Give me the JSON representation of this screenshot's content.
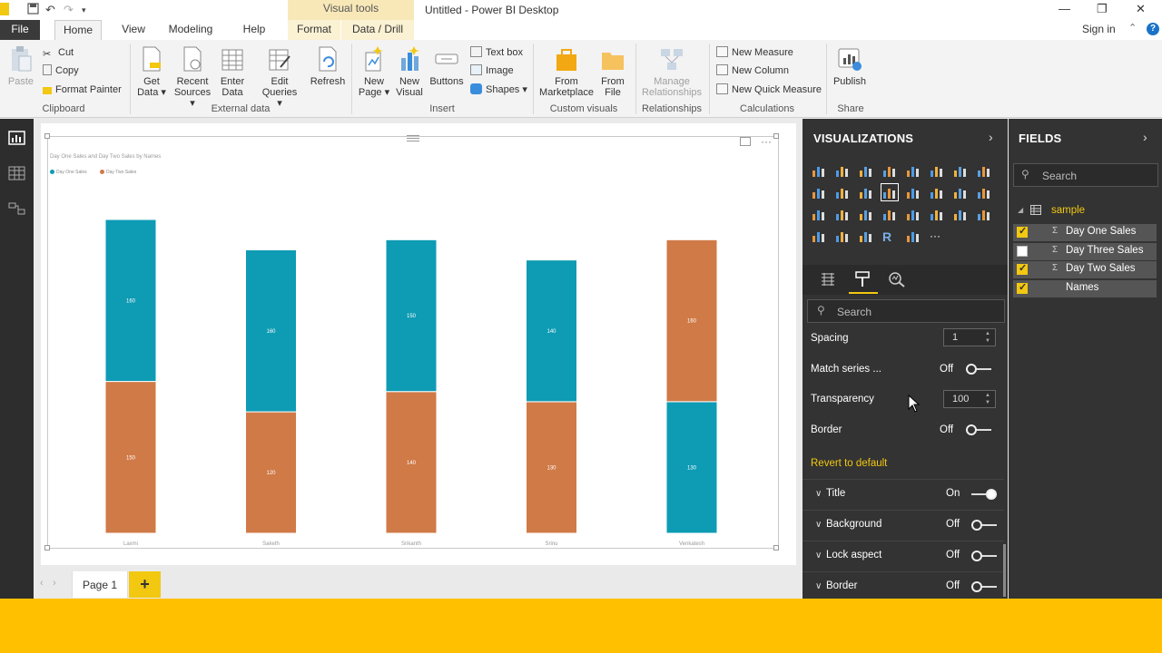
{
  "app": {
    "title": "Untitled - Power BI Desktop",
    "context_tab_group": "Visual tools",
    "sign_in": "Sign in"
  },
  "tabs": [
    "File",
    "Home",
    "View",
    "Modeling",
    "Help",
    "Format",
    "Data / Drill"
  ],
  "ribbon": {
    "clipboard": {
      "paste": "Paste",
      "cut": "Cut",
      "copy": "Copy",
      "format_painter": "Format Painter",
      "group": "Clipboard"
    },
    "external_data": {
      "get_data_1": "Get",
      "get_data_2": "Data ▾",
      "recent_1": "Recent",
      "recent_2": "Sources ▾",
      "enter_1": "Enter",
      "enter_2": "Data",
      "edit_1": "Edit",
      "edit_2": "Queries ▾",
      "refresh": "Refresh",
      "group": "External data"
    },
    "insert": {
      "new_page_1": "New",
      "new_page_2": "Page ▾",
      "new_visual_1": "New",
      "new_visual_2": "Visual",
      "buttons": "Buttons",
      "text_box": "Text box",
      "image": "Image",
      "shapes": "Shapes ▾",
      "group": "Insert"
    },
    "custom_visuals": {
      "from_marketplace_1": "From",
      "from_marketplace_2": "Marketplace",
      "from_file_1": "From",
      "from_file_2": "File",
      "group": "Custom visuals"
    },
    "relationships": {
      "manage_1": "Manage",
      "manage_2": "Relationships",
      "group": "Relationships"
    },
    "calculations": {
      "new_measure": "New Measure",
      "new_column": "New Column",
      "new_quick_measure": "New Quick Measure",
      "group": "Calculations"
    },
    "share": {
      "publish": "Publish",
      "group": "Share"
    }
  },
  "colors": {
    "day_one": "#0e9bb4",
    "day_two": "#d07a47",
    "accent": "#f2c811"
  },
  "chart_data": {
    "type": "bar",
    "stacked": true,
    "title": "Day One Sales and Day Two Sales by Names",
    "categories": [
      "Laxmi",
      "Saketh",
      "Srikanth",
      "Srinu",
      "Venkatesh"
    ],
    "series": [
      {
        "name": "Day One Sales",
        "values": [
          160,
          160,
          150,
          140,
          130
        ]
      },
      {
        "name": "Day Two Sales",
        "values": [
          150,
          120,
          140,
          130,
          160
        ]
      }
    ],
    "stack_order": [
      [
        "Day Two Sales",
        "Day One Sales"
      ],
      [
        "Day Two Sales",
        "Day One Sales"
      ],
      [
        "Day Two Sales",
        "Day One Sales"
      ],
      [
        "Day Two Sales",
        "Day One Sales"
      ],
      [
        "Day One Sales",
        "Day Two Sales"
      ]
    ],
    "ylim": [
      0,
      310
    ],
    "legend": "top-left",
    "grid": false
  },
  "pages": {
    "current": "Page 1",
    "add": "+"
  },
  "visualizations": {
    "title": "VISUALIZATIONS",
    "search_placeholder": "Search",
    "props": {
      "spacing_label": "Spacing",
      "spacing_value": "1",
      "match_series_label": "Match series ...",
      "match_series_value": "Off",
      "transparency_label": "Transparency",
      "transparency_value": "100",
      "border_label": "Border",
      "border_value": "Off",
      "revert": "Revert to default"
    },
    "sections": [
      {
        "label": "Title",
        "value": "On"
      },
      {
        "label": "Background",
        "value": "Off"
      },
      {
        "label": "Lock aspect",
        "value": "Off"
      },
      {
        "label": "Border",
        "value": "Off"
      }
    ]
  },
  "fields": {
    "title": "FIELDS",
    "search_placeholder": "Search",
    "table": "sample",
    "items": [
      {
        "label": "Day One Sales",
        "checked": true
      },
      {
        "label": "Day Three Sales",
        "checked": false
      },
      {
        "label": "Day Two Sales",
        "checked": true
      },
      {
        "label": "Names",
        "checked": true
      }
    ]
  }
}
